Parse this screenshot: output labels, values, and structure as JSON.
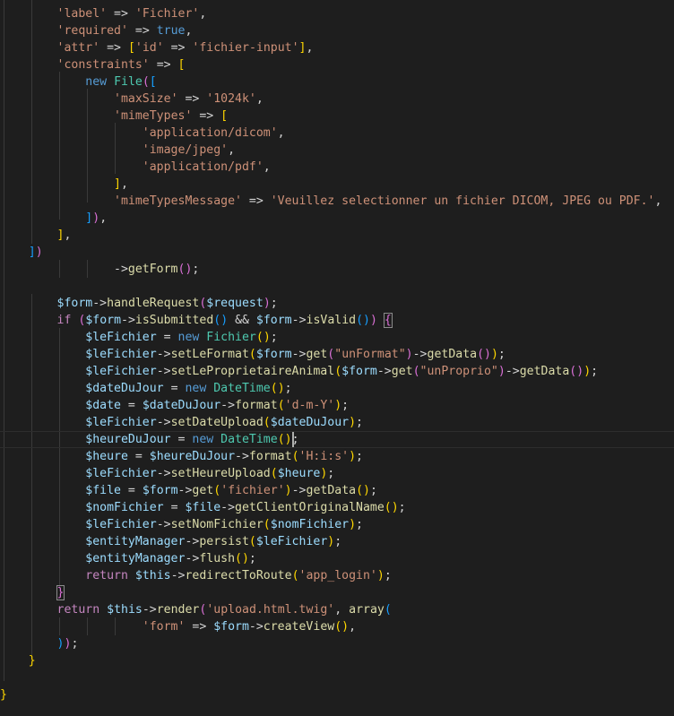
{
  "editor": {
    "language": "php",
    "colors": {
      "background": "#1e1e1e",
      "string": "#ce9178",
      "keyword": "#569cd6",
      "control": "#c586c0",
      "variable": "#9cdcfe",
      "function": "#dcdcaa",
      "class": "#4ec9b0",
      "bracket_1": "#ffd700",
      "bracket_2": "#da70d6",
      "bracket_3": "#179fff"
    },
    "lines": [
      [
        [
          "p",
          "        "
        ],
        [
          "s",
          "'label'"
        ],
        [
          "p",
          " => "
        ],
        [
          "s",
          "'Fichier'"
        ],
        [
          "p",
          ","
        ]
      ],
      [
        [
          "p",
          "        "
        ],
        [
          "s",
          "'required'"
        ],
        [
          "p",
          " => "
        ],
        [
          "k",
          "true"
        ],
        [
          "p",
          ","
        ]
      ],
      [
        [
          "p",
          "        "
        ],
        [
          "s",
          "'attr'"
        ],
        [
          "p",
          " => "
        ],
        [
          "b1",
          "["
        ],
        [
          "s",
          "'id'"
        ],
        [
          "p",
          " => "
        ],
        [
          "s",
          "'fichier-input'"
        ],
        [
          "b1",
          "]"
        ],
        [
          "p",
          ","
        ]
      ],
      [
        [
          "p",
          "        "
        ],
        [
          "s",
          "'constraints'"
        ],
        [
          "p",
          " => "
        ],
        [
          "b1",
          "["
        ]
      ],
      [
        [
          "p",
          "            "
        ],
        [
          "k",
          "new"
        ],
        [
          "p",
          " "
        ],
        [
          "c",
          "File"
        ],
        [
          "b2",
          "("
        ],
        [
          "b3",
          "["
        ]
      ],
      [
        [
          "p",
          "                "
        ],
        [
          "s",
          "'maxSize'"
        ],
        [
          "p",
          " => "
        ],
        [
          "s",
          "'1024k'"
        ],
        [
          "p",
          ","
        ]
      ],
      [
        [
          "p",
          "                "
        ],
        [
          "s",
          "'mimeTypes'"
        ],
        [
          "p",
          " => "
        ],
        [
          "b1",
          "["
        ]
      ],
      [
        [
          "p",
          "                    "
        ],
        [
          "s",
          "'application/dicom'"
        ],
        [
          "p",
          ","
        ]
      ],
      [
        [
          "p",
          "                    "
        ],
        [
          "s",
          "'image/jpeg'"
        ],
        [
          "p",
          ","
        ]
      ],
      [
        [
          "p",
          "                    "
        ],
        [
          "s",
          "'application/pdf'"
        ],
        [
          "p",
          ","
        ]
      ],
      [
        [
          "p",
          "                "
        ],
        [
          "b1",
          "]"
        ],
        [
          "p",
          ","
        ]
      ],
      [
        [
          "p",
          "                "
        ],
        [
          "s",
          "'mimeTypesMessage'"
        ],
        [
          "p",
          " => "
        ],
        [
          "s",
          "'Veuillez selectionner un fichier DICOM, JPEG ou PDF.'"
        ],
        [
          "p",
          ","
        ]
      ],
      [
        [
          "p",
          "            "
        ],
        [
          "b3",
          "]"
        ],
        [
          "b2",
          ")"
        ],
        [
          "p",
          ","
        ]
      ],
      [
        [
          "p",
          "        "
        ],
        [
          "b1",
          "]"
        ],
        [
          "p",
          ","
        ]
      ],
      [
        [
          "p",
          "    "
        ],
        [
          "b3",
          "]"
        ],
        [
          "b2",
          ")"
        ]
      ],
      [
        [
          "p",
          "                ->"
        ],
        [
          "f",
          "getForm"
        ],
        [
          "b2",
          "()"
        ],
        [
          "p",
          ";"
        ]
      ],
      [
        [
          "p",
          ""
        ]
      ],
      [
        [
          "p",
          "        "
        ],
        [
          "v",
          "$form"
        ],
        [
          "p",
          "->"
        ],
        [
          "f",
          "handleRequest"
        ],
        [
          "b2",
          "("
        ],
        [
          "v",
          "$request"
        ],
        [
          "b2",
          ")"
        ],
        [
          "p",
          ";"
        ]
      ],
      [
        [
          "p",
          "        "
        ],
        [
          "x",
          "if"
        ],
        [
          "p",
          " "
        ],
        [
          "b2",
          "("
        ],
        [
          "v",
          "$form"
        ],
        [
          "p",
          "->"
        ],
        [
          "f",
          "isSubmitted"
        ],
        [
          "b3",
          "()"
        ],
        [
          "p",
          " && "
        ],
        [
          "v",
          "$form"
        ],
        [
          "p",
          "->"
        ],
        [
          "f",
          "isValid"
        ],
        [
          "b3",
          "()"
        ],
        [
          "b2",
          ")"
        ],
        [
          "p",
          " "
        ],
        [
          "bx",
          "{"
        ]
      ],
      [
        [
          "p",
          "            "
        ],
        [
          "v",
          "$leFichier"
        ],
        [
          "p",
          " = "
        ],
        [
          "k",
          "new"
        ],
        [
          "p",
          " "
        ],
        [
          "c",
          "Fichier"
        ],
        [
          "b1",
          "()"
        ],
        [
          "p",
          ";"
        ]
      ],
      [
        [
          "p",
          "            "
        ],
        [
          "v",
          "$leFichier"
        ],
        [
          "p",
          "->"
        ],
        [
          "f",
          "setLeFormat"
        ],
        [
          "b1",
          "("
        ],
        [
          "v",
          "$form"
        ],
        [
          "p",
          "->"
        ],
        [
          "f",
          "get"
        ],
        [
          "b2",
          "("
        ],
        [
          "s",
          "\"unFormat\""
        ],
        [
          "b2",
          ")"
        ],
        [
          "p",
          "->"
        ],
        [
          "f",
          "getData"
        ],
        [
          "b2",
          "()"
        ],
        [
          "b1",
          ")"
        ],
        [
          "p",
          ";"
        ]
      ],
      [
        [
          "p",
          "            "
        ],
        [
          "v",
          "$leFichier"
        ],
        [
          "p",
          "->"
        ],
        [
          "f",
          "setLeProprietaireAnimal"
        ],
        [
          "b1",
          "("
        ],
        [
          "v",
          "$form"
        ],
        [
          "p",
          "->"
        ],
        [
          "f",
          "get"
        ],
        [
          "b2",
          "("
        ],
        [
          "s",
          "\"unProprio\""
        ],
        [
          "b2",
          ")"
        ],
        [
          "p",
          "->"
        ],
        [
          "f",
          "getData"
        ],
        [
          "b2",
          "()"
        ],
        [
          "b1",
          ")"
        ],
        [
          "p",
          ";"
        ]
      ],
      [
        [
          "p",
          "            "
        ],
        [
          "v",
          "$dateDuJour"
        ],
        [
          "p",
          " = "
        ],
        [
          "k",
          "new"
        ],
        [
          "p",
          " "
        ],
        [
          "c",
          "DateTime"
        ],
        [
          "b1",
          "()"
        ],
        [
          "p",
          ";"
        ]
      ],
      [
        [
          "p",
          "            "
        ],
        [
          "v",
          "$date"
        ],
        [
          "p",
          " = "
        ],
        [
          "v",
          "$dateDuJour"
        ],
        [
          "p",
          "->"
        ],
        [
          "f",
          "format"
        ],
        [
          "b1",
          "("
        ],
        [
          "s",
          "'d-m-Y'"
        ],
        [
          "b1",
          ")"
        ],
        [
          "p",
          ";"
        ]
      ],
      [
        [
          "p",
          "            "
        ],
        [
          "v",
          "$leFichier"
        ],
        [
          "p",
          "->"
        ],
        [
          "f",
          "setDateUpload"
        ],
        [
          "b1",
          "("
        ],
        [
          "v",
          "$dateDuJour"
        ],
        [
          "b1",
          ")"
        ],
        [
          "p",
          ";"
        ]
      ],
      [
        [
          "p",
          "            "
        ],
        [
          "v",
          "$heureDuJour"
        ],
        [
          "p",
          " = "
        ],
        [
          "k",
          "new"
        ],
        [
          "p",
          " "
        ],
        [
          "c",
          "DateTime"
        ],
        [
          "b1",
          "()"
        ],
        [
          "p",
          ";"
        ]
      ],
      [
        [
          "p",
          "            "
        ],
        [
          "v",
          "$heure"
        ],
        [
          "p",
          " = "
        ],
        [
          "v",
          "$heureDuJour"
        ],
        [
          "p",
          "->"
        ],
        [
          "f",
          "format"
        ],
        [
          "b1",
          "("
        ],
        [
          "s",
          "'H:i:s'"
        ],
        [
          "b1",
          ")"
        ],
        [
          "p",
          ";"
        ]
      ],
      [
        [
          "p",
          "            "
        ],
        [
          "v",
          "$leFichier"
        ],
        [
          "p",
          "->"
        ],
        [
          "f",
          "setHeureUpload"
        ],
        [
          "b1",
          "("
        ],
        [
          "v",
          "$heure"
        ],
        [
          "b1",
          ")"
        ],
        [
          "p",
          ";"
        ]
      ],
      [
        [
          "p",
          "            "
        ],
        [
          "v",
          "$file"
        ],
        [
          "p",
          " = "
        ],
        [
          "v",
          "$form"
        ],
        [
          "p",
          "->"
        ],
        [
          "f",
          "get"
        ],
        [
          "b1",
          "("
        ],
        [
          "s",
          "'fichier'"
        ],
        [
          "b1",
          ")"
        ],
        [
          "p",
          "->"
        ],
        [
          "f",
          "getData"
        ],
        [
          "b1",
          "()"
        ],
        [
          "p",
          ";"
        ]
      ],
      [
        [
          "p",
          "            "
        ],
        [
          "v",
          "$nomFichier"
        ],
        [
          "p",
          " = "
        ],
        [
          "v",
          "$file"
        ],
        [
          "p",
          "->"
        ],
        [
          "f",
          "getClientOriginalName"
        ],
        [
          "b1",
          "()"
        ],
        [
          "p",
          ";"
        ]
      ],
      [
        [
          "p",
          "            "
        ],
        [
          "v",
          "$leFichier"
        ],
        [
          "p",
          "->"
        ],
        [
          "f",
          "setNomFichier"
        ],
        [
          "b1",
          "("
        ],
        [
          "v",
          "$nomFichier"
        ],
        [
          "b1",
          ")"
        ],
        [
          "p",
          ";"
        ]
      ],
      [
        [
          "p",
          "            "
        ],
        [
          "v",
          "$entityManager"
        ],
        [
          "p",
          "->"
        ],
        [
          "f",
          "persist"
        ],
        [
          "b1",
          "("
        ],
        [
          "v",
          "$leFichier"
        ],
        [
          "b1",
          ")"
        ],
        [
          "p",
          ";"
        ]
      ],
      [
        [
          "p",
          "            "
        ],
        [
          "v",
          "$entityManager"
        ],
        [
          "p",
          "->"
        ],
        [
          "f",
          "flush"
        ],
        [
          "b1",
          "()"
        ],
        [
          "p",
          ";"
        ]
      ],
      [
        [
          "p",
          "            "
        ],
        [
          "x",
          "return"
        ],
        [
          "p",
          " "
        ],
        [
          "v",
          "$this"
        ],
        [
          "p",
          "->"
        ],
        [
          "f",
          "redirectToRoute"
        ],
        [
          "b1",
          "("
        ],
        [
          "s",
          "'app_login'"
        ],
        [
          "b1",
          ")"
        ],
        [
          "p",
          ";"
        ]
      ],
      [
        [
          "p",
          "        "
        ],
        [
          "bx",
          "}"
        ]
      ],
      [
        [
          "p",
          "        "
        ],
        [
          "x",
          "return"
        ],
        [
          "p",
          " "
        ],
        [
          "v",
          "$this"
        ],
        [
          "p",
          "->"
        ],
        [
          "f",
          "render"
        ],
        [
          "b2",
          "("
        ],
        [
          "s",
          "'upload.html.twig'"
        ],
        [
          "p",
          ", "
        ],
        [
          "f",
          "array"
        ],
        [
          "b3",
          "("
        ]
      ],
      [
        [
          "p",
          "                    "
        ],
        [
          "s",
          "'form'"
        ],
        [
          "p",
          " => "
        ],
        [
          "v",
          "$form"
        ],
        [
          "p",
          "->"
        ],
        [
          "f",
          "createView"
        ],
        [
          "b1",
          "()"
        ],
        [
          "p",
          ","
        ]
      ],
      [
        [
          "p",
          "        "
        ],
        [
          "b3",
          ")"
        ],
        [
          "b2",
          ")"
        ],
        [
          "p",
          ";"
        ]
      ],
      [
        [
          "p",
          "    "
        ],
        [
          "b1",
          "}"
        ]
      ],
      [
        [
          "p",
          ""
        ]
      ],
      [
        [
          "p",
          ""
        ],
        [
          "b1",
          "}"
        ]
      ]
    ],
    "cursor_line": 25
  }
}
